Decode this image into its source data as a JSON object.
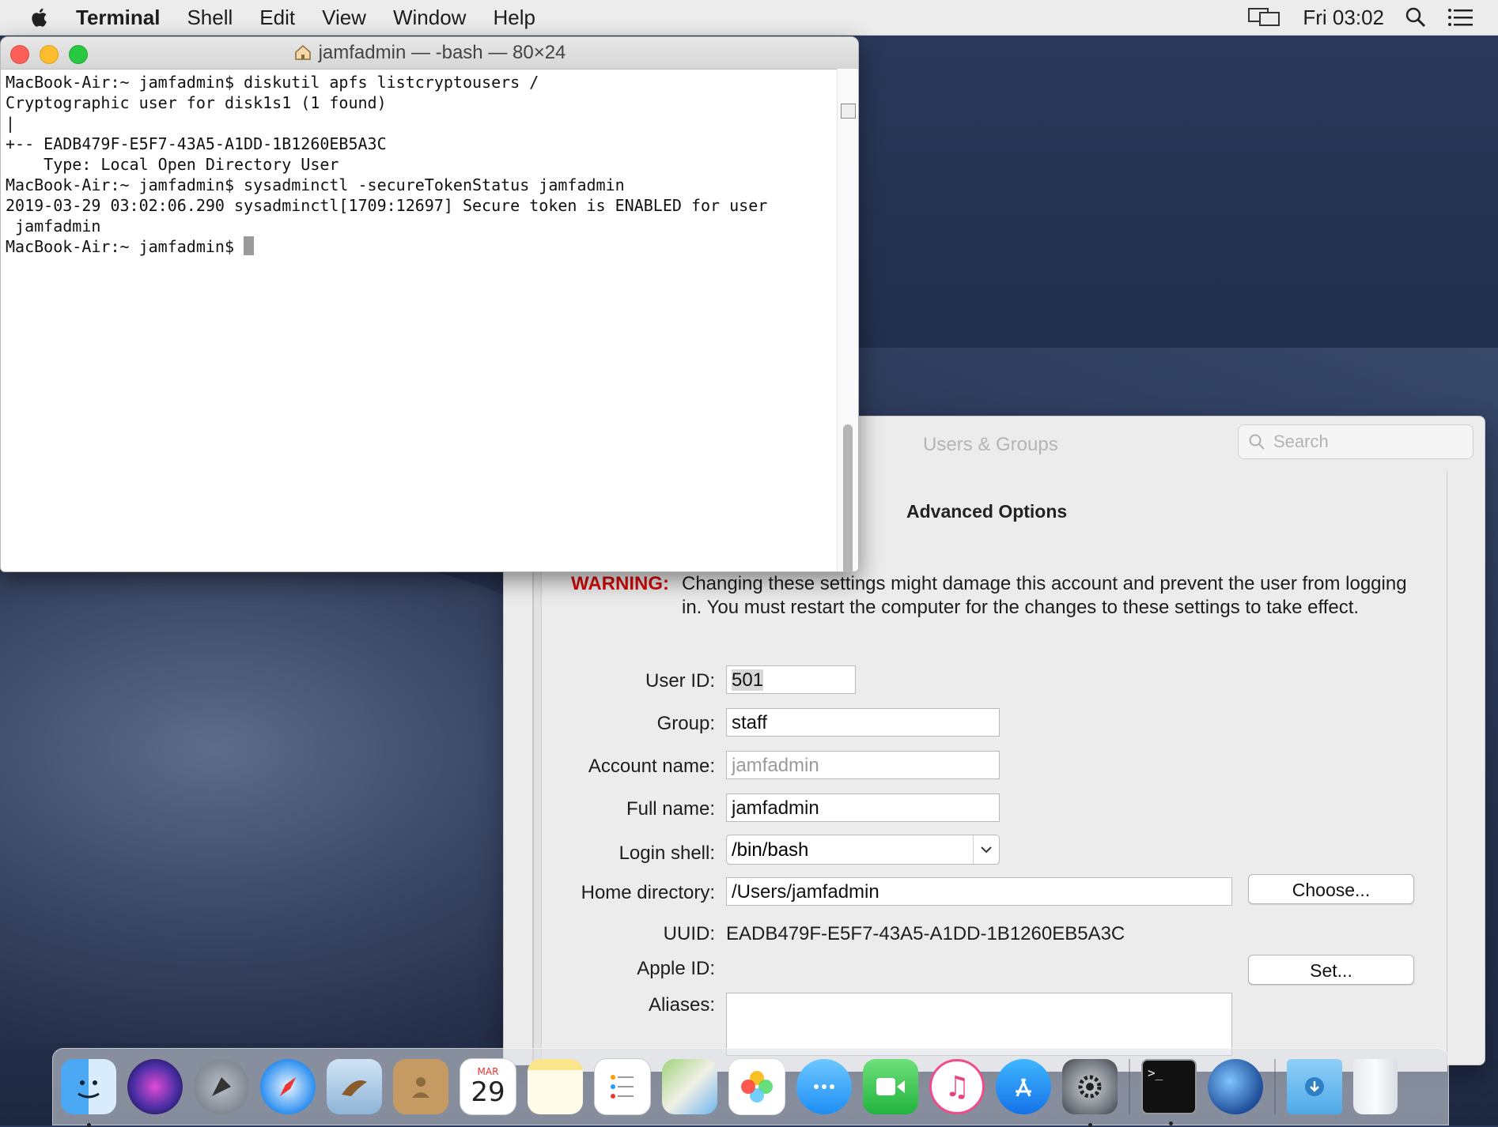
{
  "menubar": {
    "app": "Terminal",
    "items": [
      "Shell",
      "Edit",
      "View",
      "Window",
      "Help"
    ],
    "clock": "Fri 03:02",
    "icons": [
      "apple-icon",
      "display-mirror-icon",
      "spotlight-search-icon",
      "notification-center-icon"
    ]
  },
  "terminal": {
    "title": "jamfadmin — -bash — 80×24",
    "lines": [
      "MacBook-Air:~ jamfadmin$ diskutil apfs listcryptousers /",
      "Cryptographic user for disk1s1 (1 found)",
      "|",
      "+-- EADB479F-E5F7-43A5-A1DD-1B1260EB5A3C",
      "    Type: Local Open Directory User",
      "",
      "MacBook-Air:~ jamfadmin$ sysadminctl -secureTokenStatus jamfadmin",
      "2019-03-29 03:02:06.290 sysadminctl[1709:12697] Secure token is ENABLED for user",
      " jamfadmin"
    ],
    "prompt": "MacBook-Air:~ jamfadmin$ "
  },
  "users_groups": {
    "title": "Users & Groups",
    "search_placeholder": "Search"
  },
  "advanced": {
    "title": "Advanced Options",
    "warning_label": "WARNING:",
    "warning_text": "Changing these settings might damage this account and prevent the user from logging in. You must restart the computer for the changes to these settings to take effect.",
    "user_id_label": "User ID:",
    "user_id": "501",
    "group_label": "Group:",
    "group": "staff",
    "account_name_label": "Account name:",
    "account_name": "jamfadmin",
    "full_name_label": "Full name:",
    "full_name": "jamfadmin",
    "login_shell_label": "Login shell:",
    "login_shell": "/bin/bash",
    "home_dir_label": "Home directory:",
    "home_dir": "/Users/jamfadmin",
    "choose_button": "Choose...",
    "uuid_label": "UUID:",
    "uuid": "EADB479F-E5F7-43A5-A1DD-1B1260EB5A3C",
    "apple_id_label": "Apple ID:",
    "set_button": "Set...",
    "aliases_label": "Aliases:",
    "aliases": ""
  },
  "dock": {
    "calendar_month": "MAR",
    "calendar_day": "29",
    "terminal_glyph": ">_",
    "icons": [
      "finder-icon",
      "siri-icon",
      "launchpad-icon",
      "safari-icon",
      "mail-icon",
      "contacts-icon",
      "calendar-icon",
      "notes-icon",
      "reminders-icon",
      "maps-icon",
      "photos-icon",
      "messages-icon",
      "facetime-icon",
      "itunes-icon",
      "app-store-icon",
      "system-preferences-icon",
      "terminal-icon",
      "network-utility-icon",
      "downloads-folder-icon",
      "trash-icon"
    ]
  }
}
